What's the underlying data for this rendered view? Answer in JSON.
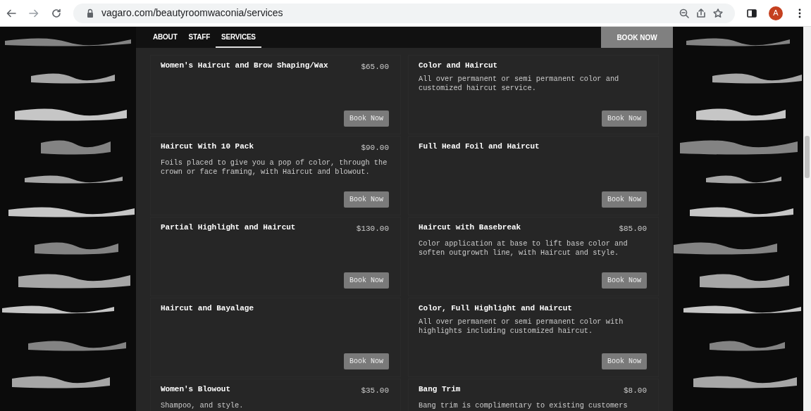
{
  "browser": {
    "url": "vagaro.com/beautyroomwaconia/services",
    "profile_initial": "A"
  },
  "nav": {
    "tabs": [
      {
        "label": "ABOUT",
        "selected": false
      },
      {
        "label": "STAFF",
        "selected": false
      },
      {
        "label": "SERVICES",
        "selected": true
      }
    ],
    "book_button": "BOOK NOW"
  },
  "services": [
    {
      "name": "Women's Haircut and Brow Shaping/Wax",
      "price": "$65.00",
      "button": "Book Now"
    },
    {
      "name": "Color and Haircut",
      "description": "All over permanent or semi permanent color and customized haircut service.",
      "button": "Book Now"
    },
    {
      "name": "Haircut With 10 Pack",
      "price": "$90.00",
      "description": "Foils placed to give you a pop of color, through the crown or face framing, with Haircut and blowout.",
      "button": "Book Now"
    },
    {
      "name": "Full Head Foil and Haircut",
      "button": "Book Now"
    },
    {
      "name": "Partial Highlight and Haircut",
      "price": "$130.00",
      "button": "Book Now"
    },
    {
      "name": "Haircut with Basebreak",
      "price": "$85.00",
      "description": "Color application at base to lift base color and soften outgrowth line, with Haircut and style.",
      "button": "Book Now"
    },
    {
      "name": "Haircut and Bayalage",
      "button": "Book Now"
    },
    {
      "name": "Color, Full Highlight and Haircut",
      "description": "All over permanent or semi permanent color with highlights including customized haircut.",
      "button": "Book Now"
    },
    {
      "name": "Women's Blowout",
      "price": "$35.00",
      "description": "Shampoo, and style."
    },
    {
      "name": "Bang Trim",
      "price": "$8.00",
      "description": "Bang trim is complimentary to existing customers"
    }
  ]
}
